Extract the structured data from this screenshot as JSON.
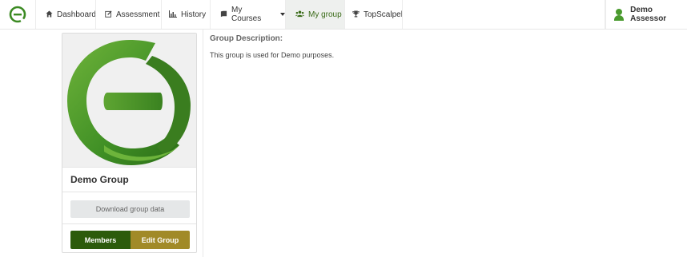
{
  "navbar": {
    "logo_icon": "brand-logo-icon",
    "items": [
      {
        "label": "Dashboard",
        "icon": "home-icon"
      },
      {
        "label": "Assessment",
        "icon": "edit-icon"
      },
      {
        "label": "History",
        "icon": "bar-chart-icon"
      },
      {
        "label": "My Courses",
        "icon": "book-icon"
      },
      {
        "label": "My group",
        "icon": "users-icon"
      },
      {
        "label": "TopScalpel",
        "icon": "trophy-icon"
      }
    ],
    "active_item": "My group",
    "user": {
      "name": "Demo Assessor",
      "icon": "user-icon"
    }
  },
  "group_card": {
    "title": "Demo Group",
    "download_label": "Download group data",
    "members_label": "Members",
    "edit_label": "Edit Group"
  },
  "description": {
    "label": "Group Description:",
    "text": "This group is used for Demo purposes."
  },
  "colors": {
    "brand_green": "#4a9a2e",
    "dark_green": "#2c5b0c",
    "gold": "#a18a27",
    "active_text": "#3a6b18"
  }
}
